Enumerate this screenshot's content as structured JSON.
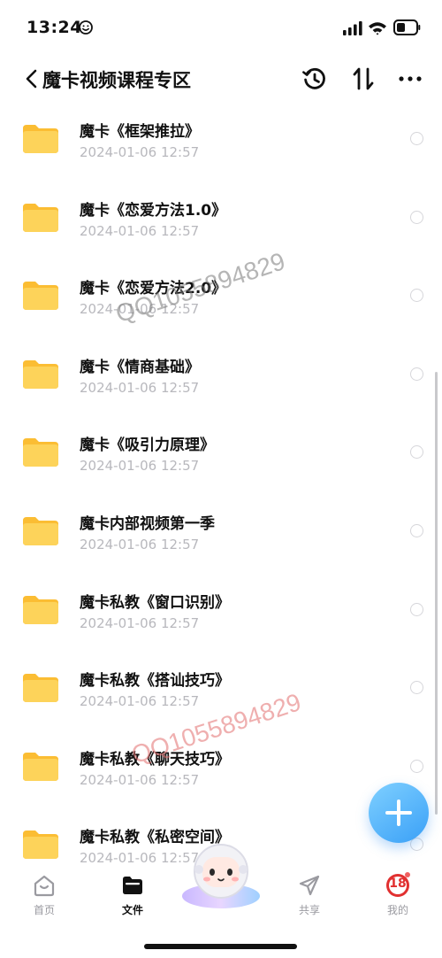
{
  "status_bar": {
    "time": "13:24"
  },
  "header": {
    "title": "魔卡视频课程专区"
  },
  "files": [
    {
      "name": "魔卡《框架推拉》",
      "date": "2024-01-06 12:57"
    },
    {
      "name": "魔卡《恋爱方法1.0》",
      "date": "2024-01-06 12:57"
    },
    {
      "name": "魔卡《恋爱方法2.0》",
      "date": "2024-01-06 12:57"
    },
    {
      "name": "魔卡《情商基础》",
      "date": "2024-01-06 12:57"
    },
    {
      "name": "魔卡《吸引力原理》",
      "date": "2024-01-06 12:57"
    },
    {
      "name": "魔卡内部视频第一季",
      "date": "2024-01-06 12:57"
    },
    {
      "name": "魔卡私教《窗口识别》",
      "date": "2024-01-06 12:57"
    },
    {
      "name": "魔卡私教《搭讪技巧》",
      "date": "2024-01-06 12:57"
    },
    {
      "name": "魔卡私教《聊天技巧》",
      "date": "2024-01-06 12:57"
    },
    {
      "name": "魔卡私教《私密空间》",
      "date": "2024-01-06 12:57"
    }
  ],
  "watermarks": [
    "QQ1055894829",
    "QQ1055894829"
  ],
  "tabs": [
    {
      "label": "首页",
      "icon": "home-icon",
      "active": false
    },
    {
      "label": "文件",
      "icon": "folder-icon",
      "active": true
    },
    {
      "label": "共享",
      "icon": "share-icon",
      "active": false
    },
    {
      "label": "我的",
      "icon": "avatar",
      "active": false
    }
  ],
  "avatar_badge": "18",
  "colors": {
    "accent": "#3aa0f7",
    "folder": "#fcc84a",
    "date_gray": "#b8b8bd"
  }
}
